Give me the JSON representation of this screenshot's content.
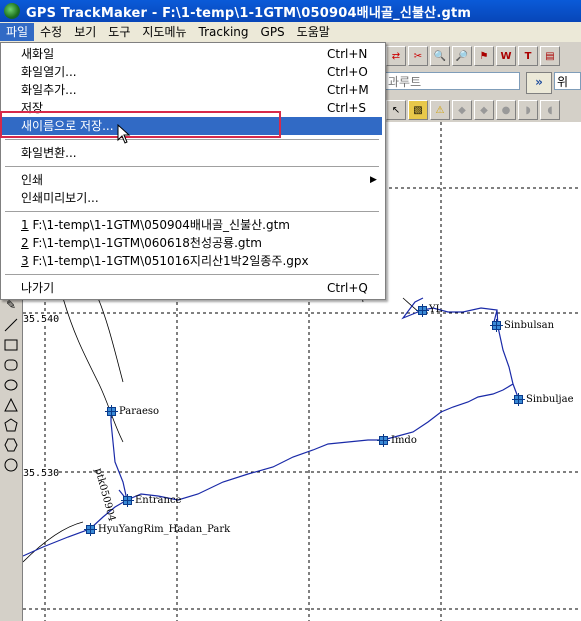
{
  "window": {
    "title": "GPS TrackMaker - F:\\1-temp\\1-1GTM\\050904배내골_신불산.gtm"
  },
  "menubar": {
    "items": [
      {
        "label": "파일",
        "active": true
      },
      {
        "label": "수정",
        "active": false
      },
      {
        "label": "보기",
        "active": false
      },
      {
        "label": "도구",
        "active": false
      },
      {
        "label": "지도메뉴",
        "active": false
      },
      {
        "label": "Tracking",
        "active": false
      },
      {
        "label": "GPS",
        "active": false
      },
      {
        "label": "도움말",
        "active": false
      }
    ]
  },
  "file_menu": {
    "new": {
      "label": "새화일",
      "shortcut": "Ctrl+N"
    },
    "open": {
      "label": "화일열기...",
      "shortcut": "Ctrl+O"
    },
    "add": {
      "label": "화일추가...",
      "shortcut": "Ctrl+M"
    },
    "save": {
      "label": "저장",
      "shortcut": "Ctrl+S"
    },
    "save_as": {
      "label": "새이름으로 저장..."
    },
    "convert": {
      "label": "화일변환..."
    },
    "print": {
      "label": "인쇄"
    },
    "print_preview": {
      "label": "인쇄미리보기..."
    },
    "recent": [
      {
        "num": "1",
        "path": " F:\\1-temp\\1-1GTM\\050904배내골_신불산.gtm"
      },
      {
        "num": "2",
        "path": " F:\\1-temp\\1-1GTM\\060618천성공룡.gtm"
      },
      {
        "num": "3",
        "path": " F:\\1-temp\\1-1GTM\\051016지리산1박2일종주.gpx"
      }
    ],
    "exit": {
      "label": "나가기",
      "shortcut": "Ctrl+Q"
    }
  },
  "toolbar": {
    "route_field": "과루트",
    "go_label": "»",
    "route_field2": "위"
  },
  "map": {
    "lat_labels": [
      "35.540",
      "35.530"
    ],
    "track_label": "ptk050904",
    "waypoints": [
      {
        "name": "YL"
      },
      {
        "name": "Sinbulsan"
      },
      {
        "name": "Sinbuljae"
      },
      {
        "name": "Paraeso"
      },
      {
        "name": "Imdo"
      },
      {
        "name": "Entrance"
      },
      {
        "name": "HyuYangRim_Hadan_Park"
      }
    ]
  },
  "colors": {
    "titlebar": "#0a5ad8",
    "menu_highlight": "#316ac5",
    "track_line": "#1a2aa8",
    "callout_box": "#d62a4a"
  }
}
